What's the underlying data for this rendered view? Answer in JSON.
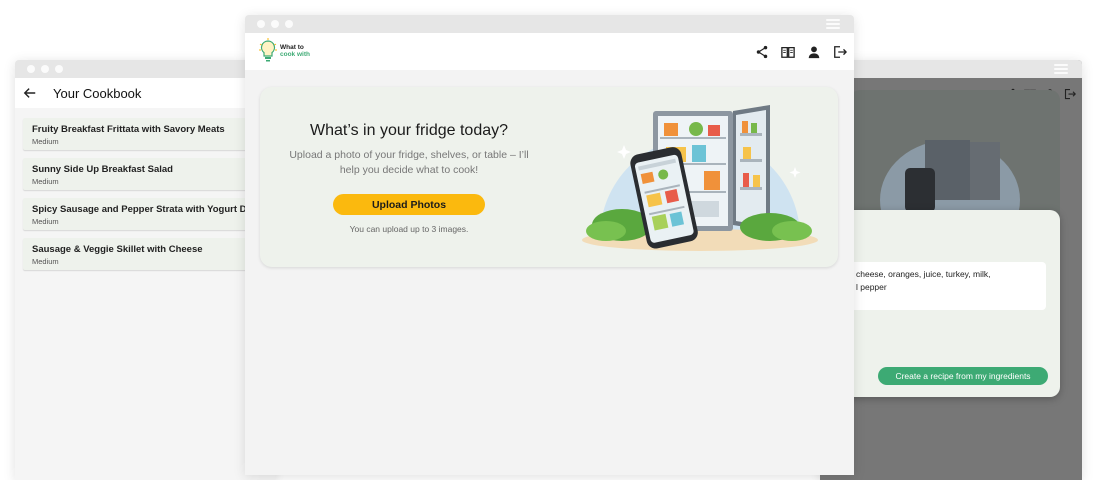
{
  "cookbook": {
    "title": "Your Cookbook",
    "recipes": [
      {
        "name": "Fruity Breakfast Frittata with Savory Meats",
        "difficulty": "Medium"
      },
      {
        "name": "Sunny Side Up Breakfast Salad",
        "difficulty": "Medium"
      },
      {
        "name": "Spicy Sausage and Pepper Strata with Yogurt Drizzle",
        "difficulty": "Medium"
      },
      {
        "name": "Sausage & Veggie Skillet with Cheese",
        "difficulty": "Medium"
      }
    ]
  },
  "main": {
    "logo": {
      "line1": "What to",
      "line2": "cook with"
    },
    "toolbar_icons": [
      "share-icon",
      "book-icon",
      "user-icon",
      "logout-icon"
    ],
    "hero": {
      "title": "What’s in your fridge today?",
      "subtitle": "Upload a photo of your fridge, shelves, or table – I’ll help you decide what to cook!",
      "upload_label": "Upload Photos",
      "upload_note": "You can upload up to 3 images."
    }
  },
  "modal": {
    "ingredients_line1": "cheese, oranges, juice, turkey, milk,",
    "ingredients_line2": "l pepper",
    "create_label": "Create a recipe from my ingredients"
  },
  "colors": {
    "accent_yellow": "#fbb90e",
    "accent_green": "#3daa74",
    "card_bg": "#eef2ec"
  }
}
